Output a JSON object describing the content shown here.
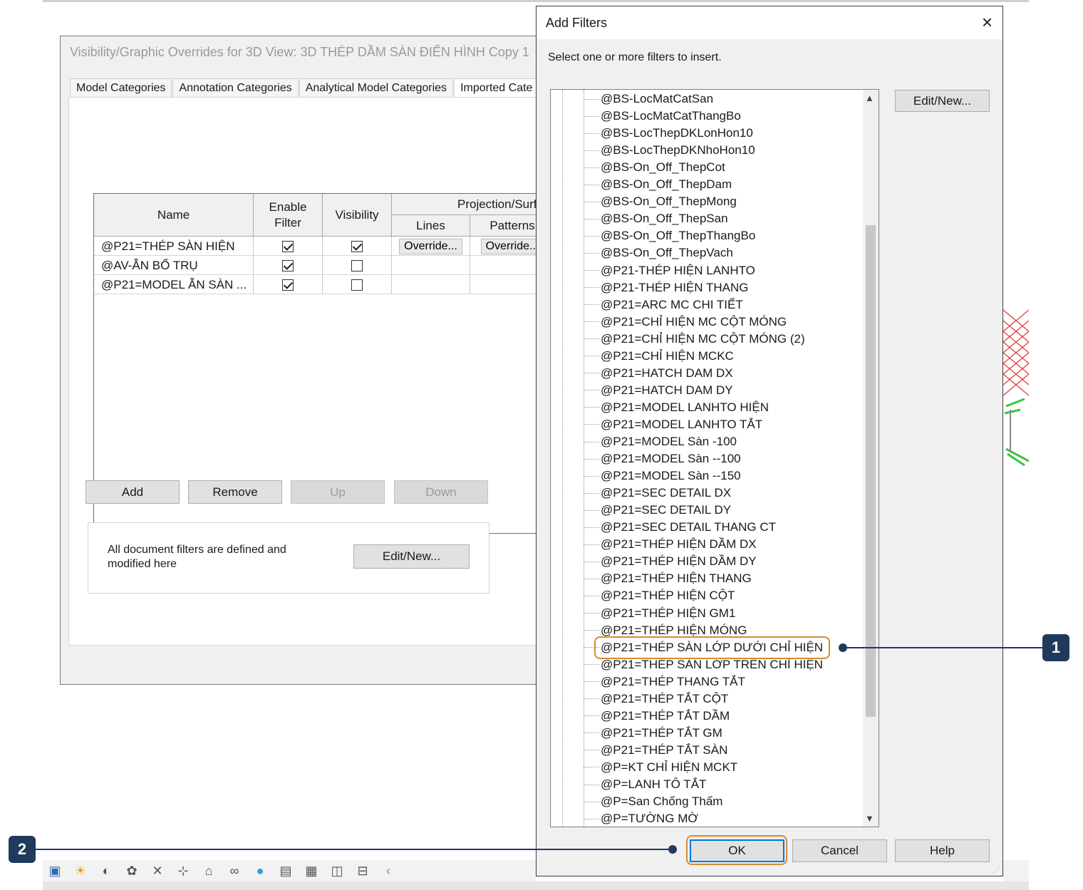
{
  "vg": {
    "title": "Visibility/Graphic Overrides for 3D View: 3D THÉP DẦM SÀN ĐIỂN HÌNH Copy 1",
    "tabs": [
      "Model Categories",
      "Annotation Categories",
      "Analytical Model Categories",
      "Imported Cate"
    ],
    "headers": {
      "name": "Name",
      "enable_filter": "Enable\nFilter",
      "visibility": "Visibility",
      "projection": "Projection/Surf",
      "lines": "Lines",
      "patterns": "Patterns"
    },
    "rows": [
      {
        "name": "@P21=THÉP SÀN HIỆN",
        "enable": true,
        "visible": true,
        "lines": "Override...",
        "patterns": "Override..."
      },
      {
        "name": "@AV-ẪN BỔ TRỤ",
        "enable": true,
        "visible": false,
        "lines": "",
        "patterns": ""
      },
      {
        "name": "@P21=MODEL ẪN SÀN ...",
        "enable": true,
        "visible": false,
        "lines": "",
        "patterns": ""
      }
    ],
    "buttons": {
      "add": "Add",
      "remove": "Remove",
      "up": "Up",
      "down": "Down"
    },
    "doc_note": "All document filters are defined and modified here",
    "edit_new": "Edit/New..."
  },
  "add_filters": {
    "title": "Add Filters",
    "close": "×",
    "instruction": "Select one or more filters to insert.",
    "edit_new": "Edit/New...",
    "items": [
      "@BS-LocMatCatSan",
      "@BS-LocMatCatThangBo",
      "@BS-LocThepDKLonHon10",
      "@BS-LocThepDKNhoHon10",
      "@BS-On_Off_ThepCot",
      "@BS-On_Off_ThepDam",
      "@BS-On_Off_ThepMong",
      "@BS-On_Off_ThepSan",
      "@BS-On_Off_ThepThangBo",
      "@BS-On_Off_ThepVach",
      "@P21-THÉP HIỆN LANHTO",
      "@P21-THÉP HIỆN THANG",
      "@P21=ARC MC CHI TIẾT",
      "@P21=CHỈ HIỆN MC CỘT MÓNG",
      "@P21=CHỈ HIỆN MC CỘT MÓNG (2)",
      "@P21=CHỈ HIỆN MCKC",
      "@P21=HATCH DAM DX",
      "@P21=HATCH DAM DY",
      "@P21=MODEL LANHTO HIỆN",
      "@P21=MODEL LANHTO TẮT",
      "@P21=MODEL Sàn -100",
      "@P21=MODEL Sàn --100",
      "@P21=MODEL Sàn --150",
      "@P21=SEC DETAIL DX",
      "@P21=SEC DETAIL DY",
      "@P21=SEC DETAIL THANG CT",
      "@P21=THÉP  HIỆN  DẦM DX",
      "@P21=THÉP HIỆN  DẦM DY",
      "@P21=THÉP HIỆN  THANG",
      "@P21=THÉP HIỆN CỘT",
      "@P21=THÉP HIỆN GM1",
      "@P21=THÉP HIỆN MÓNG",
      "@P21=THÉP SÀN LỚP DƯỚI CHỈ HIỆN",
      "@P21=THÉP SÀN LỚP TRÊN CHỈ HIỆN",
      "@P21=THÉP THANG TẮT",
      "@P21=THÉP TẮT  CỘT",
      "@P21=THÉP TẮT  DẦM",
      "@P21=THÉP TẮT GM",
      "@P21=THÉP TẮT SÀN",
      "@P=KT CHỈ HIỆN MCKT",
      "@P=LANH TÔ TẮT",
      "@P=San Chống Thấm",
      "@P=TƯỜNG MỜ"
    ],
    "buttons": {
      "ok": "OK",
      "cancel": "Cancel",
      "help": "Help"
    }
  },
  "callouts": [
    "1",
    "2"
  ],
  "colors": {
    "highlight": "#d68b30",
    "callout": "#1f3a5c"
  }
}
